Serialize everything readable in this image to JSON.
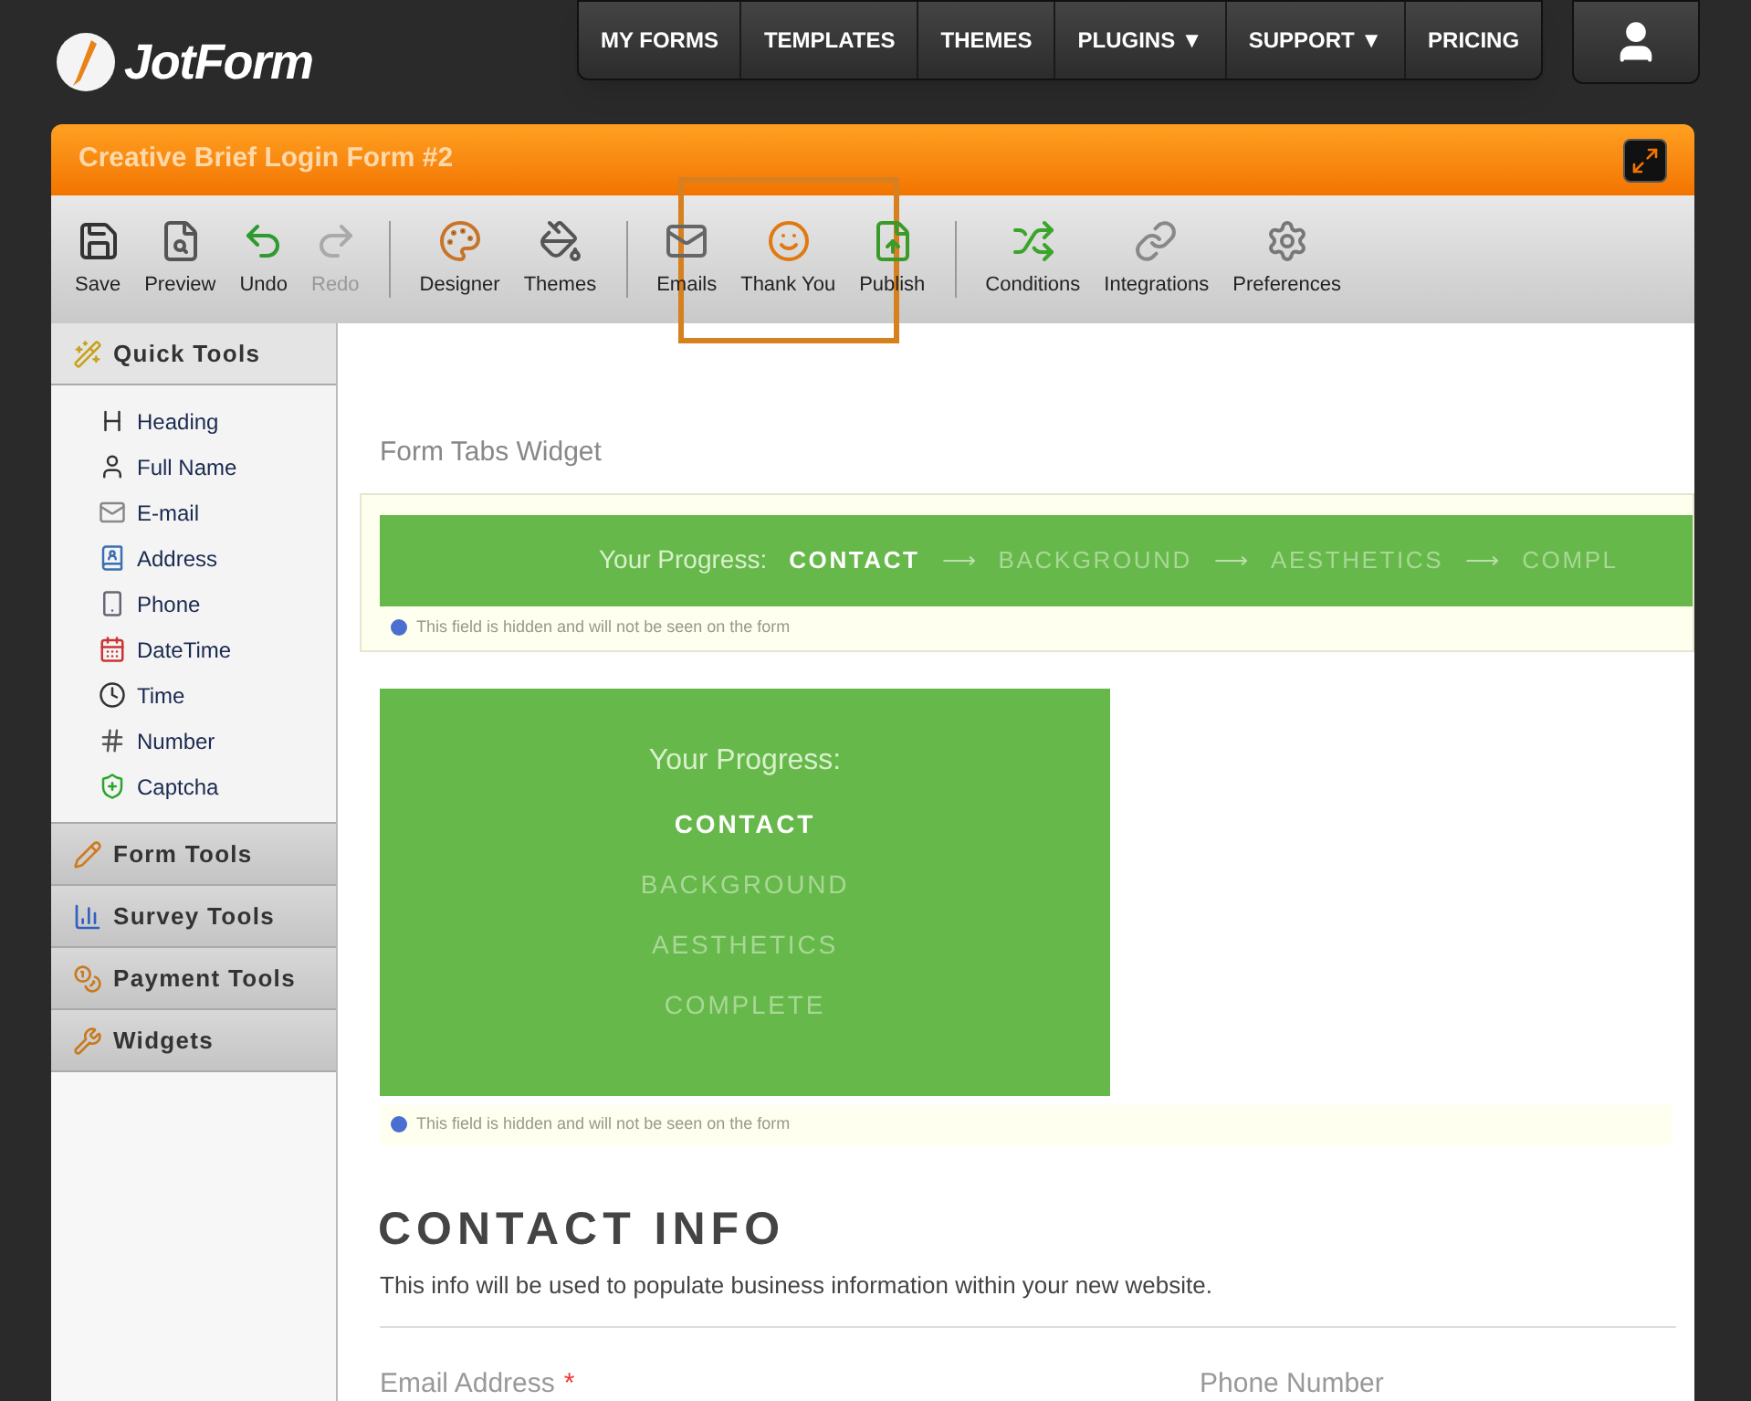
{
  "header": {
    "logo": "JotForm",
    "nav": [
      {
        "label": "MY FORMS"
      },
      {
        "label": "TEMPLATES"
      },
      {
        "label": "THEMES"
      },
      {
        "label": "PLUGINS ▼"
      },
      {
        "label": "SUPPORT ▼"
      },
      {
        "label": "PRICING"
      }
    ]
  },
  "builder": {
    "form_title": "Creative Brief Login Form #2",
    "toolbar": [
      {
        "label": "Save",
        "separator_before": false,
        "disabled": false,
        "highlighted": false
      },
      {
        "label": "Preview",
        "separator_before": false,
        "disabled": false,
        "highlighted": false
      },
      {
        "label": "Undo",
        "separator_before": false,
        "disabled": false,
        "highlighted": false
      },
      {
        "label": "Redo",
        "separator_before": false,
        "disabled": true,
        "highlighted": false
      },
      {
        "label": "Designer",
        "separator_before": true,
        "disabled": false,
        "highlighted": false
      },
      {
        "label": "Themes",
        "separator_before": false,
        "disabled": false,
        "highlighted": false
      },
      {
        "label": "Emails",
        "separator_before": true,
        "disabled": false,
        "highlighted": false
      },
      {
        "label": "Thank You",
        "separator_before": false,
        "disabled": false,
        "highlighted": true
      },
      {
        "label": "Publish",
        "separator_before": false,
        "disabled": false,
        "highlighted": false
      },
      {
        "label": "Conditions",
        "separator_before": true,
        "disabled": false,
        "highlighted": false
      },
      {
        "label": "Integrations",
        "separator_before": false,
        "disabled": false,
        "highlighted": false
      },
      {
        "label": "Preferences",
        "separator_before": false,
        "disabled": false,
        "highlighted": false
      }
    ],
    "sidebar": [
      {
        "title": "Quick Tools",
        "expanded": true,
        "items": [
          {
            "label": "Heading"
          },
          {
            "label": "Full Name"
          },
          {
            "label": "E-mail"
          },
          {
            "label": "Address"
          },
          {
            "label": "Phone"
          },
          {
            "label": "DateTime"
          },
          {
            "label": "Time"
          },
          {
            "label": "Number"
          },
          {
            "label": "Captcha"
          }
        ]
      },
      {
        "title": "Form Tools",
        "expanded": false
      },
      {
        "title": "Survey Tools",
        "expanded": false
      },
      {
        "title": "Payment Tools",
        "expanded": false
      },
      {
        "title": "Widgets",
        "expanded": false
      }
    ],
    "form": {
      "widget_label": "Form Tabs Widget",
      "horizontal_tabs": {
        "progress_label": "Your Progress:",
        "separator": "⟶",
        "steps": [
          {
            "label": "CONTACT",
            "selected": true
          },
          {
            "label": "BACKGROUND",
            "selected": false
          },
          {
            "label": "AESTHETICS",
            "selected": false
          },
          {
            "label": "COMPL",
            "selected": false
          }
        ],
        "hidden_note": "This field is hidden and will not be seen on the form"
      },
      "vertical_tabs": {
        "progress_label": "Your Progress:",
        "steps": [
          {
            "label": "CONTACT",
            "selected": true
          },
          {
            "label": "BACKGROUND",
            "selected": false
          },
          {
            "label": "AESTHETICS",
            "selected": false
          },
          {
            "label": "COMPLETE",
            "selected": false
          }
        ],
        "hidden_note": "This field is hidden and will not be seen on the form"
      },
      "section_title": "CONTACT INFO",
      "section_description": "This info will be used to populate business information within your new website.",
      "fields": [
        {
          "label": "Email Address",
          "required": true,
          "required_mark": "*"
        },
        {
          "label": "Phone Number",
          "required": false
        }
      ]
    }
  }
}
